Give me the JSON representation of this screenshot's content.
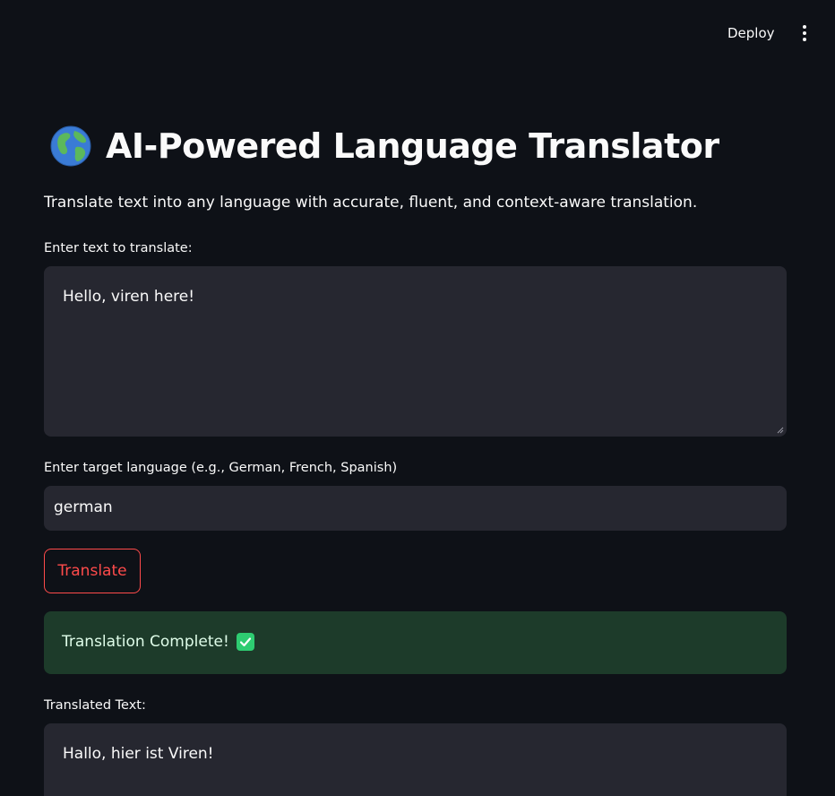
{
  "header": {
    "deploy_label": "Deploy",
    "menu_icon": "vertical-ellipsis-icon"
  },
  "main": {
    "title_icon": "globe-icon",
    "title": "AI-Powered Language Translator",
    "subtitle": "Translate text into any language with accurate, fluent, and context-aware translation.",
    "source_label": "Enter text to translate:",
    "source_value": "Hello, viren here!",
    "target_label": "Enter target language (e.g., German, French, Spanish)",
    "target_value": "german",
    "translate_button": "Translate",
    "success_message": "Translation Complete!",
    "success_icon": "check-mark-icon",
    "output_label": "Translated Text:",
    "output_value": "Hallo, hier ist Viren!"
  },
  "colors": {
    "background": "#0e1117",
    "input_bg": "#262730",
    "accent": "#ff4b4b",
    "success_bg": "#1d3b2a",
    "check": "#2ecc71"
  }
}
